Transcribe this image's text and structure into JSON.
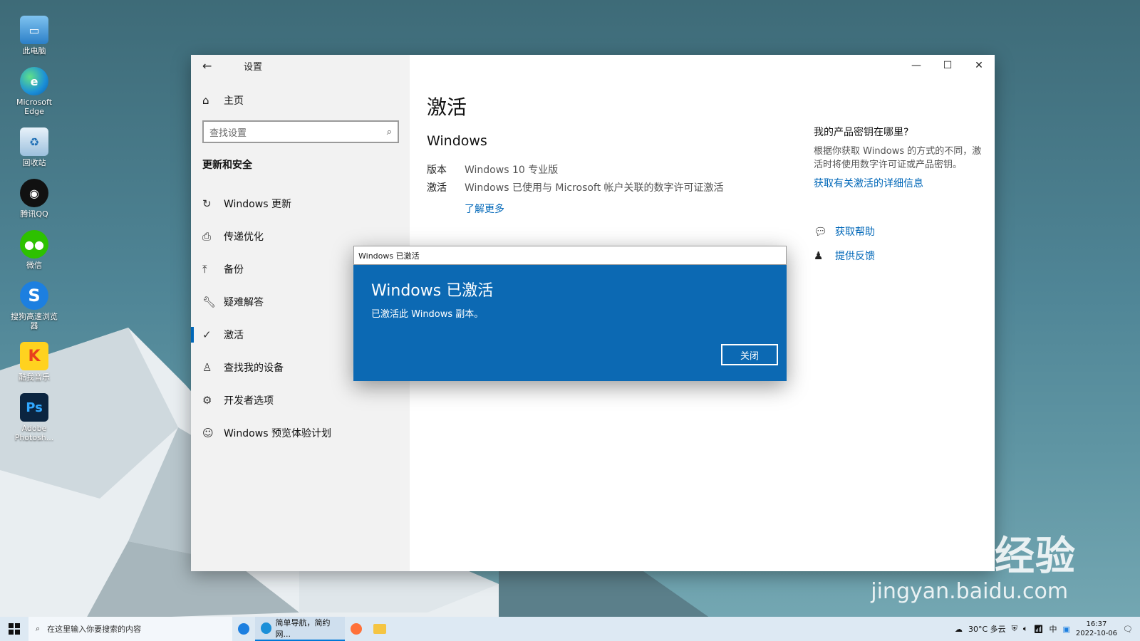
{
  "desktop": {
    "icons": [
      {
        "label": "此电脑",
        "icon": "computer-icon"
      },
      {
        "label": "Microsoft Edge",
        "icon": "edge-icon"
      },
      {
        "label": "回收站",
        "icon": "recycle-bin-icon"
      },
      {
        "label": "腾讯QQ",
        "icon": "qq-icon"
      },
      {
        "label": "微信",
        "icon": "wechat-icon"
      },
      {
        "label": "搜狗高速浏览器",
        "icon": "sogou-browser-icon"
      },
      {
        "label": "酷我音乐",
        "icon": "kuwo-music-icon"
      },
      {
        "label": "Adobe Photosh...",
        "icon": "photoshop-icon"
      }
    ]
  },
  "settings": {
    "window_title": "设置",
    "home": "主页",
    "search_placeholder": "查找设置",
    "section": "更新和安全",
    "nav": [
      {
        "label": "Windows 更新",
        "icon": "refresh-icon"
      },
      {
        "label": "传递优化",
        "icon": "delivery-icon"
      },
      {
        "label": "备份",
        "icon": "upload-arrow-icon"
      },
      {
        "label": "疑难解答",
        "icon": "wrench-icon"
      },
      {
        "label": "激活",
        "icon": "check-circle-icon",
        "active": true
      },
      {
        "label": "查找我的设备",
        "icon": "person-pin-icon"
      },
      {
        "label": "开发者选项",
        "icon": "dev-tools-icon"
      },
      {
        "label": "Windows 预览体验计划",
        "icon": "insider-cat-icon"
      }
    ],
    "page_title": "激活",
    "sub_title": "Windows",
    "edition_label": "版本",
    "edition_value": "Windows 10 专业版",
    "activation_label": "激活",
    "activation_value": "Windows 已使用与 Microsoft 帐户关联的数字许可证激活",
    "learn_more": "了解更多",
    "right": {
      "heading": "我的产品密钥在哪里?",
      "paragraph": "根据你获取 Windows 的方式的不同，激活时将使用数字许可证或产品密钥。",
      "link": "获取有关激活的详细信息",
      "help": "获取帮助",
      "feedback": "提供反馈"
    }
  },
  "dialog": {
    "title_bar": "Windows 已激活",
    "heading": "Windows 已激活",
    "text": "已激活此 Windows 副本。",
    "close_button": "关闭"
  },
  "taskbar": {
    "search_placeholder": "在这里输入你要搜索的内容",
    "running_app": "简单导航，简约网...",
    "weather": "30°C  多云",
    "time": "16:37",
    "date": "2022-10-06"
  },
  "watermark": {
    "line1": "Baidu经验",
    "line2": "jingyan.baidu.com"
  }
}
